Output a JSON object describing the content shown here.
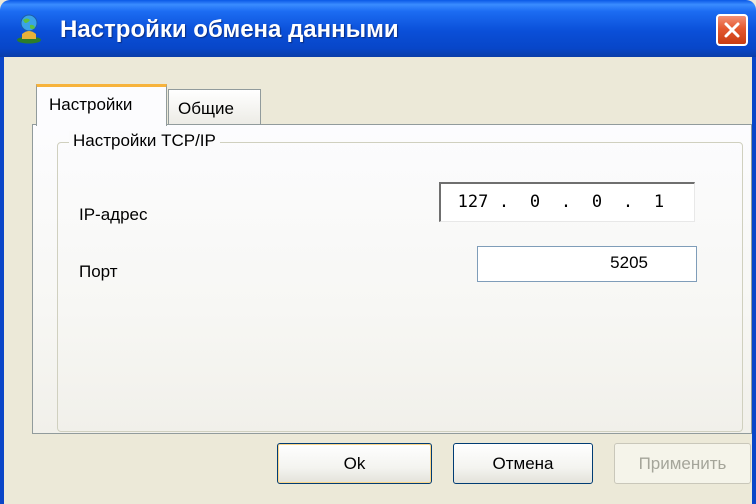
{
  "window": {
    "title": "Настройки обмена данными",
    "icon": "globe-user-icon",
    "close_icon": "close-icon"
  },
  "tabs": [
    {
      "label": "Настройки",
      "active": true
    },
    {
      "label": "Общие",
      "active": false
    }
  ],
  "group": {
    "legend": "Настройки TCP/IP"
  },
  "fields": {
    "ip_label": "IP-адрес",
    "ip_octets": [
      "127",
      "0",
      "0",
      "1"
    ],
    "ip_separator": ".",
    "port_label": "Порт",
    "port_value": "5205"
  },
  "buttons": {
    "ok": "Ok",
    "cancel": "Отмена",
    "apply": "Применить",
    "apply_enabled": false
  },
  "colors": {
    "titlebar": "#0a4fd8",
    "close_button": "#e4582f",
    "active_tab_accent": "#f7b33c"
  }
}
